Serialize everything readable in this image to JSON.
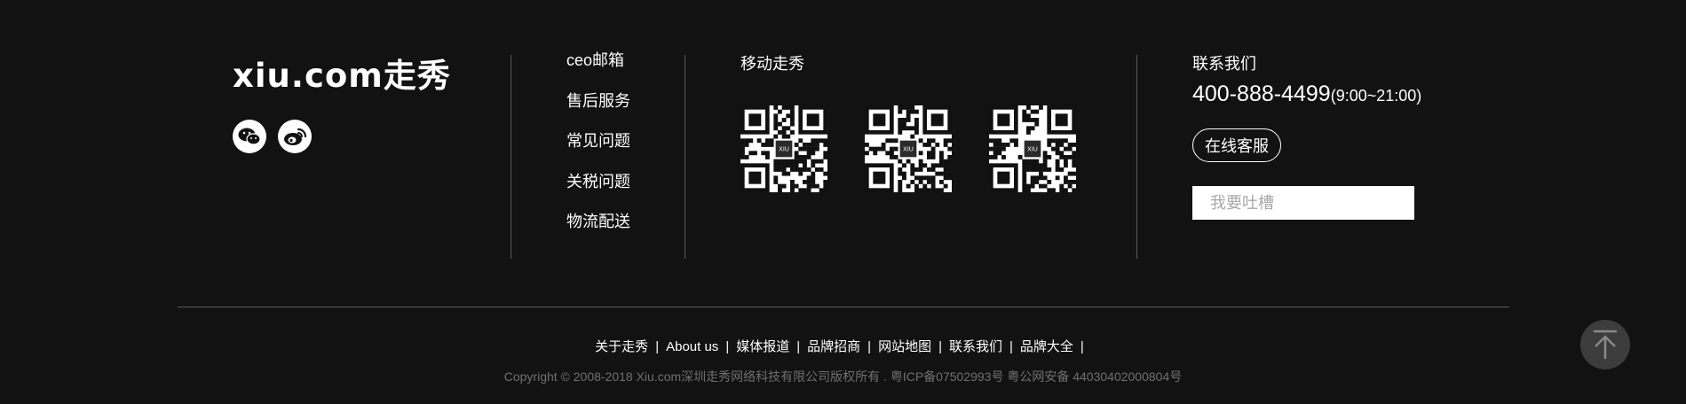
{
  "logo": {
    "text": "xiu.com走秀"
  },
  "social": [
    {
      "name": "wechat-icon"
    },
    {
      "name": "weibo-icon"
    }
  ],
  "links": [
    "ceo邮箱",
    "售后服务",
    "常见问题",
    "关税问题",
    "物流配送"
  ],
  "mobile": {
    "title": "移动走秀",
    "qr_badge": "XIU"
  },
  "contact": {
    "title": "联系我们",
    "phone": "400-888-4499",
    "hours": "(9:00~21:00)",
    "online_label": "在线客服",
    "feedback_placeholder": "我要吐槽"
  },
  "bottom_links": [
    "关于走秀",
    "About us",
    "媒体报道",
    "品牌招商",
    "网站地图",
    "联系我们",
    "品牌大全"
  ],
  "copyright": "Copyright © 2008-2018 Xiu.com深圳走秀网络科技有限公司版权所有 . 粤ICP备07502993号 粤公网安备 44030402000804号",
  "colors": {
    "background": "#121212",
    "divider": "#5a5a5a",
    "muted_text": "#6f6f6f",
    "backtop": "#3c3c3c"
  }
}
